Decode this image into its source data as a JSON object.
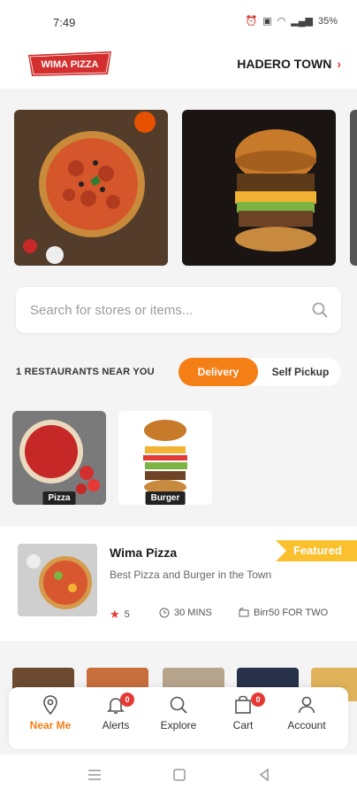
{
  "status_bar": {
    "time": "7:49",
    "battery": "35%"
  },
  "header": {
    "brand": "WIMA PIZZA",
    "location": "HADERO TOWN"
  },
  "search": {
    "placeholder": "Search for stores or items..."
  },
  "filter": {
    "near_count": "1 RESTAURANTS NEAR YOU",
    "delivery": "Delivery",
    "pickup": "Self Pickup",
    "selected": "Delivery"
  },
  "categories": [
    {
      "label": "Pizza"
    },
    {
      "label": "Burger"
    }
  ],
  "store": {
    "name": "Wima Pizza",
    "description": "Best Pizza and Burger in the Town",
    "badge": "Featured",
    "rating": "5",
    "time": "30 MINS",
    "price": "Birr50 FOR TWO"
  },
  "bottom_nav": [
    {
      "label": "Near Me",
      "icon": "map-pin-icon",
      "active": true
    },
    {
      "label": "Alerts",
      "icon": "bell-icon",
      "badge": "0"
    },
    {
      "label": "Explore",
      "icon": "search-icon"
    },
    {
      "label": "Cart",
      "icon": "shopping-bag-icon",
      "badge": "0"
    },
    {
      "label": "Account",
      "icon": "user-icon"
    }
  ],
  "colors": {
    "accent": "#f57f17",
    "brand_red": "#e53935",
    "featured": "#fbc02d"
  }
}
